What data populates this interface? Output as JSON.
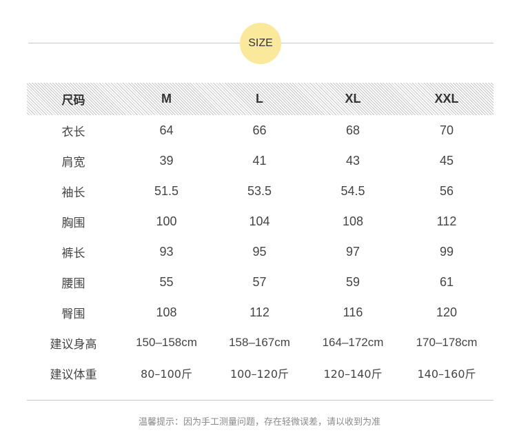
{
  "badge": {
    "label": "SIZE"
  },
  "table": {
    "header": [
      "尺码",
      "M",
      "L",
      "XL",
      "XXL"
    ],
    "rows": [
      {
        "label": "衣长",
        "values": [
          "64",
          "66",
          "68",
          "70"
        ]
      },
      {
        "label": "肩宽",
        "values": [
          "39",
          "41",
          "43",
          "45"
        ]
      },
      {
        "label": "袖长",
        "values": [
          "51.5",
          "53.5",
          "54.5",
          "56"
        ]
      },
      {
        "label": "胸围",
        "values": [
          "100",
          "104",
          "108",
          "112"
        ]
      },
      {
        "label": "裤长",
        "values": [
          "93",
          "95",
          "97",
          "99"
        ]
      },
      {
        "label": "腰围",
        "values": [
          "55",
          "57",
          "59",
          "61"
        ]
      },
      {
        "label": "臀围",
        "values": [
          "108",
          "112",
          "116",
          "120"
        ]
      },
      {
        "label": "建议身高",
        "values": [
          "150–158cm",
          "158–167cm",
          "164–172cm",
          "170–178cm"
        ]
      },
      {
        "label": "建议体重",
        "values": [
          "80–100斤",
          "100–120斤",
          "120–140斤",
          "140–160斤"
        ]
      }
    ]
  },
  "footer": {
    "note": "温馨提示：因为手工测量问题，存在轻微误差，请以收到为准"
  },
  "colors": {
    "badge_fill": "#fbe99b",
    "header_stripe": "#c4c4c4",
    "rule": "#c8c8c8",
    "text": "#444444",
    "footer_text": "#8a8a8a"
  }
}
